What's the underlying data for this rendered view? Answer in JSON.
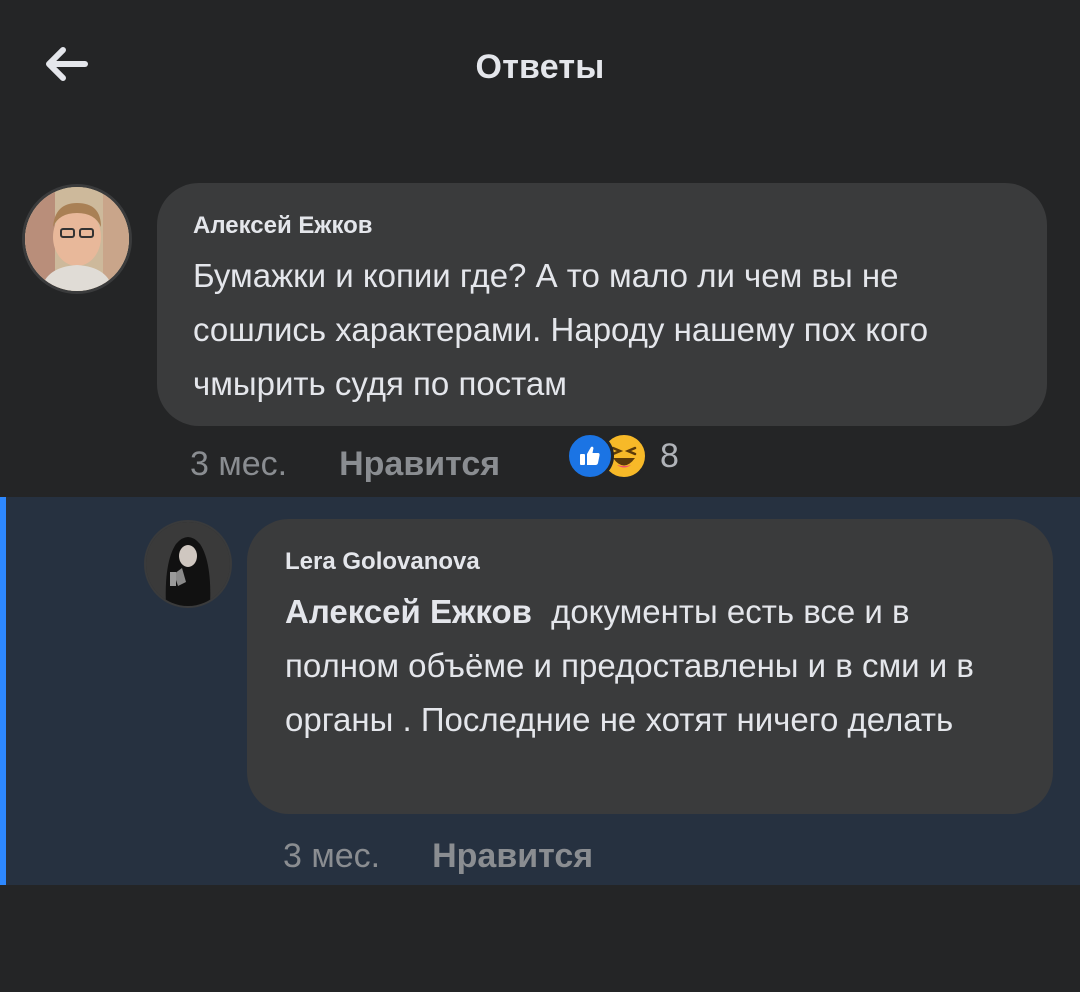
{
  "header": {
    "title": "Ответы",
    "back_icon": "arrow-left-icon"
  },
  "comment": {
    "author": "Алексей Ежков",
    "text": "Бумажки и копии где? А то мало ли чем вы не сошлись характерами. Народу нашему пох кого чмырить судя по постам",
    "time": "3 мес.",
    "like_label": "Нравится",
    "reaction_icons": [
      "like-icon",
      "haha-icon"
    ],
    "reaction_count": "8"
  },
  "reply": {
    "author": "Lera Golovanova",
    "mention": "Алексей Ежков",
    "text": "документы есть все и в полном объёме и предоставлены и в сми и в  органы . Последние не хотят ничего делать",
    "time": "3 мес.",
    "like_label": "Нравится"
  },
  "colors": {
    "background": "#242526",
    "bubble": "#3a3b3c",
    "reply_highlight": "#263140",
    "accent": "#2d88ff",
    "like_blue": "#1b74e4",
    "haha_yellow": "#f7b928"
  }
}
